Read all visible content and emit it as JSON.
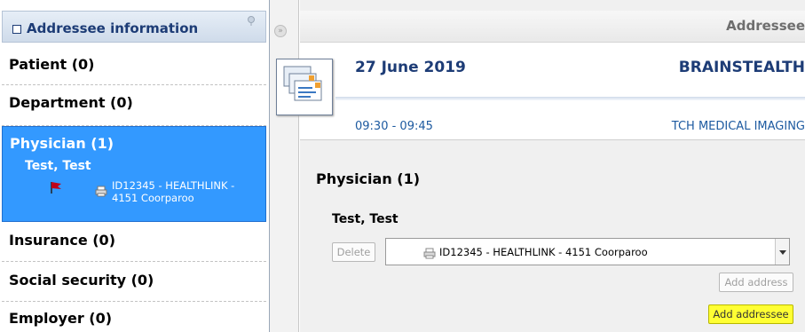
{
  "sidebar": {
    "header_title": "Addressee information",
    "items": {
      "patient": "Patient (0)",
      "department": "Department (0)",
      "physician": "Physician (1)",
      "insurance": "Insurance (0)",
      "social_security": "Social security (0)",
      "employer": "Employer (0)"
    },
    "selected": {
      "name": "Test, Test",
      "address_line1": "ID12345 - HEALTHLINK -",
      "address_line2": "4151 Coorparoo"
    }
  },
  "main": {
    "title": "Addressee",
    "appointment": {
      "date": "27 June 2019",
      "organization": "BRAINSTEALTH",
      "time": "09:30 - 09:45",
      "department": "TCH MEDICAL IMAGING"
    },
    "section_title": "Physician (1)",
    "person_name": "Test, Test",
    "delete_label": "Delete",
    "address_select_value": "ID12345 - HEALTHLINK - 4151 Coorparoo",
    "add_address_label": "Add address",
    "add_addressee_label": "Add addressee"
  },
  "colors": {
    "selected_bg": "#3399ff",
    "header_text": "#1d3c76",
    "highlight": "#ffff33"
  },
  "icons": [
    "checkbox-icon",
    "pin-icon",
    "flag-icon",
    "printer-icon",
    "collapse-icon",
    "letters-icon",
    "dropdown-arrow-icon"
  ]
}
